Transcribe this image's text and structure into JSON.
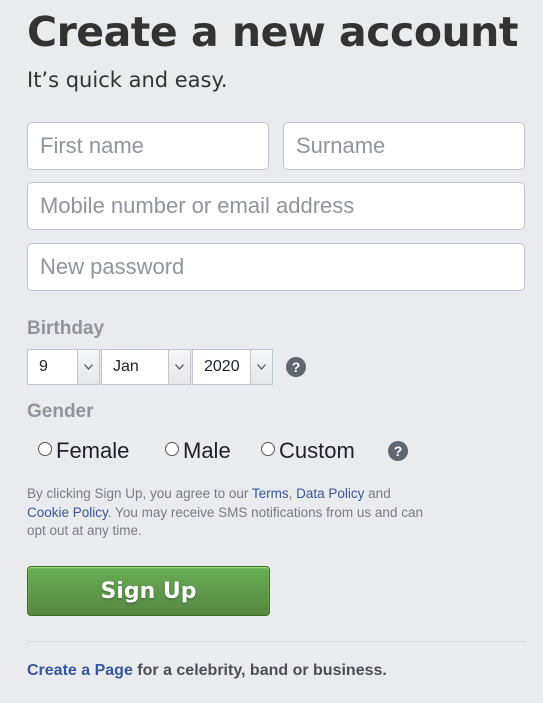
{
  "header": {
    "title": "Create a new account",
    "subtitle": "It’s quick and easy."
  },
  "form": {
    "first_name_placeholder": "First name",
    "surname_placeholder": "Surname",
    "contact_placeholder": "Mobile number or email address",
    "password_placeholder": "New password"
  },
  "birthday": {
    "label": "Birthday",
    "day": "9",
    "month": "Jan",
    "year": "2020",
    "help_icon": "?"
  },
  "gender": {
    "label": "Gender",
    "options": [
      "Female",
      "Male",
      "Custom"
    ],
    "selected": null,
    "help_icon": "?"
  },
  "terms": {
    "prefix": "By clicking Sign Up, you agree to our ",
    "terms_link": "Terms",
    "separator": ", ",
    "data_policy_link": "Data Policy",
    "and": " and ",
    "cookie_policy_link": "Cookie Policy",
    "suffix": ". You may receive SMS notifications from us and can opt out at any time."
  },
  "signup": {
    "button_label": "Sign Up"
  },
  "footer": {
    "create_page_link": "Create a Page",
    "create_page_suffix": " for a celebrity, band or business."
  },
  "colors": {
    "background": "#e9ebee",
    "link": "#365899",
    "button_green": "#5b9a48",
    "label_gray": "#90949c"
  },
  "icons": {
    "select_arrow": "chevron-down-icon",
    "help": "question-mark-icon",
    "radio": "radio-icon"
  }
}
